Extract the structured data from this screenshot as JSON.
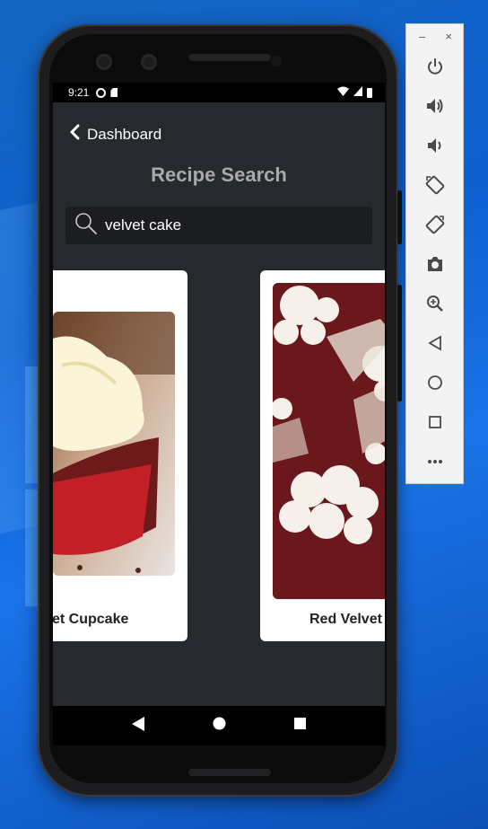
{
  "emulator": {
    "minimize_label": "–",
    "close_label": "×"
  },
  "statusbar": {
    "time": "9:21"
  },
  "app": {
    "back_label": "Dashboard",
    "title": "Recipe Search",
    "search_value": "velvet cake"
  },
  "results": [
    {
      "title": "et Cupcake"
    },
    {
      "title": "Red Velvet"
    }
  ],
  "colors": {
    "screen_bg": "#26292e",
    "search_bg": "#1b1d21",
    "title_gray": "#a8a8ad",
    "desktop_blue": "#1565c0"
  }
}
